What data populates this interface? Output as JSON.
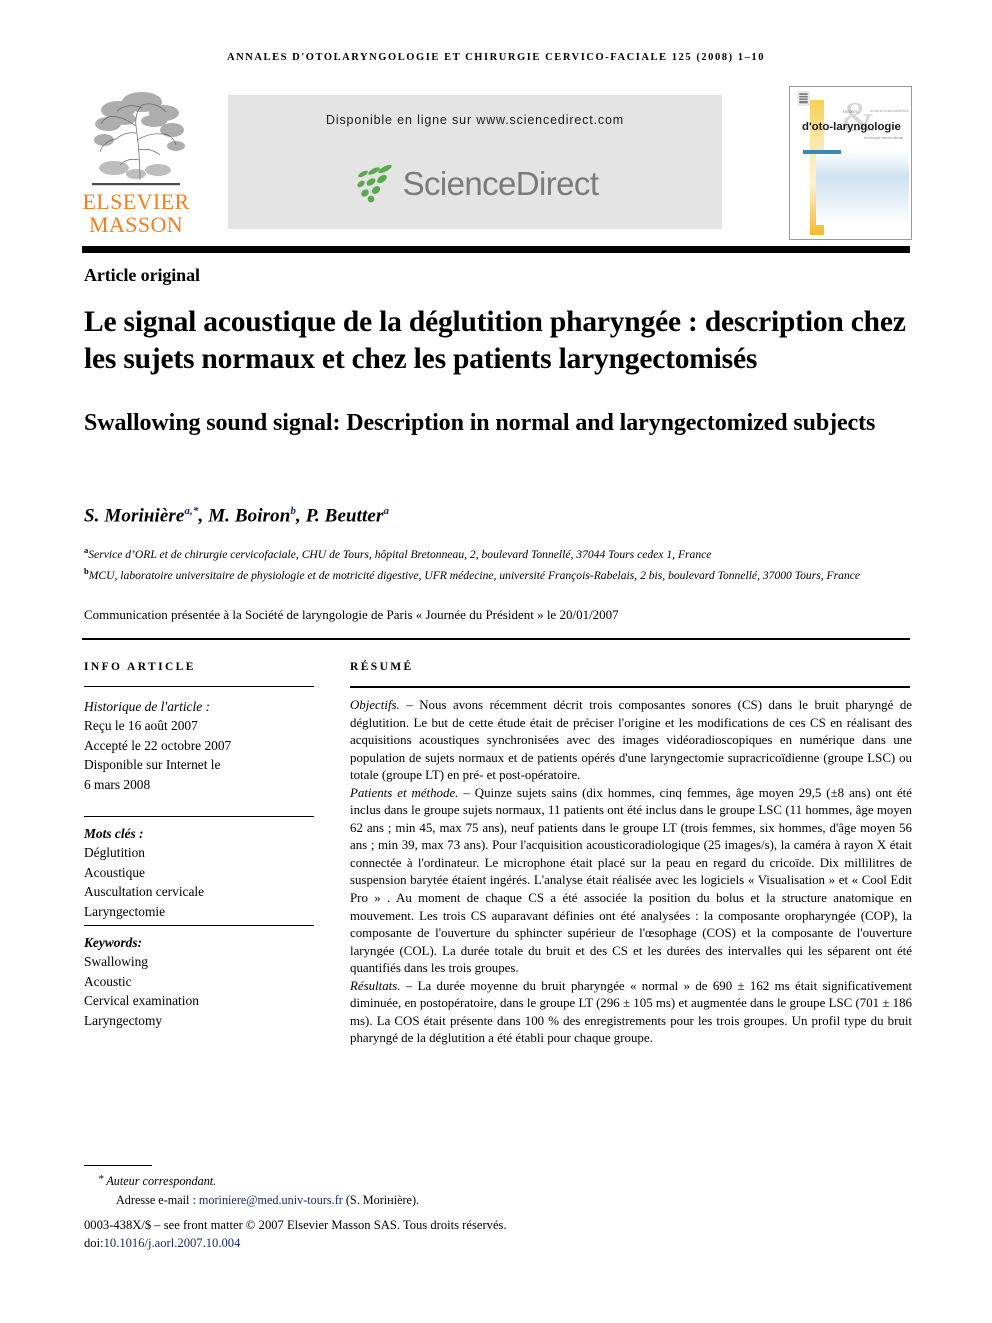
{
  "running_head": "Annales d'otolaryngologie et chirurgie cervico-faciale 125 (2008) 1–10",
  "masthead": {
    "publisher_logo_name": "elsevier-masson-logo",
    "publisher_line1": "ELSEVIER",
    "publisher_line2": "MASSON",
    "publisher_color": "#ef8022",
    "sciencedirect_availability": "Disponible en ligne sur www.sciencedirect.com",
    "sciencedirect_wordmark": "ScienceDirect",
    "sciencedirect_mark_color": "#5aa94f",
    "sciencedirect_word_color": "#7b7b7b",
    "banner_bg": "#e4e4e4",
    "journal_cover_title": "d'oto-laryngologie",
    "journal_cover_superline": "Annales",
    "journal_cover_subline": "et de chirurgie cervico-faciale",
    "journal_cover_accent_yellow": "#f5c53d",
    "journal_cover_accent_blue": "#4a8fc0"
  },
  "article": {
    "kicker": "Article original",
    "title_fr": "Le signal acoustique de la déglutition pharyngée : description chez les sujets normaux et chez les patients laryngectomisés",
    "title_en": "Swallowing sound signal: Description in normal and laryngectomized subjects",
    "authors": [
      {
        "name": "S. Moriнière",
        "display": "S. Moriнière",
        "sup": "a,*"
      },
      {
        "name": "M. Boiron",
        "display": "M. Boiron",
        "sup": "b"
      },
      {
        "name": "P. Beutter",
        "display": "P. Beutter",
        "sup": "a"
      }
    ],
    "authors_plain": "S. Moriнière a,*, M. Boiron b, P. Beutter a",
    "affiliations": [
      {
        "marker": "a",
        "text": "Service d’ORL et de chirurgie cervicofaciale, CHU de Tours, hôpital Bretonneau, 2, boulevard Tonnellé, 37044 Tours cedex 1, France"
      },
      {
        "marker": "b",
        "text": "MCU, laboratoire universitaire de physiologie et de motricité digestive, UFR médecine, université François-Rabelais, 2 bis, boulevard Tonnellé, 37000 Tours, France"
      }
    ],
    "communication": "Communication présentée à la Société de laryngologie de Paris « Journée du Président » le 20/01/2007"
  },
  "info_article": {
    "heading": "INFO ARTICLE",
    "history_label": "Historique de l'article :",
    "history": [
      "Reçu le 16 août 2007",
      "Accepté le  22 octobre 2007",
      "Disponible sur Internet le",
      "6 mars 2008"
    ],
    "motscles_label": "Mots clés :",
    "motscles": [
      "Déglutition",
      "Acoustique",
      "Auscultation cervicale",
      "Laryngectomie"
    ],
    "keywords_label": "Keywords:",
    "keywords": [
      "Swallowing",
      "Acoustic",
      "Cervical examination",
      "Laryngectomy"
    ]
  },
  "resume": {
    "heading": "RÉSUMÉ",
    "paragraphs": [
      {
        "lead": "Objectifs. – ",
        "body": "Nous avons récemment décrit trois composantes sonores (CS) dans le bruit pharyngé de déglutition. Le but de cette étude était de préciser l'origine et les modifications de ces CS en réalisant des acquisitions acoustiques synchronisées avec des images vidéoradioscopiques en numérique dans une population de sujets normaux et de patients opérés d'une laryngectomie supracricoïdienne (groupe LSC) ou totale (groupe LT) en pré- et post-opératoire."
      },
      {
        "lead": "Patients et méthode. – ",
        "body": "Quinze sujets sains (dix hommes, cinq femmes, âge moyen 29,5 (±8 ans) ont été inclus dans le groupe sujets normaux, 11 patients ont été inclus dans le groupe LSC (11 hommes, âge moyen 62 ans ; min 45, max 75 ans), neuf patients dans le groupe LT (trois femmes, six hommes, d'âge moyen 56 ans ; min 39, max 73 ans). Pour l'acquisition acousticoradiologique (25 images/s), la caméra à rayon X était connectée à l'ordinateur. Le microphone était placé sur la peau en regard du cricoïde. Dix millilitres de suspension barytée étaient ingérés. L'analyse était réalisée avec les logiciels « Visualisation » et « Cool Edit Pro » . Au moment de chaque CS a été associée la position du bolus et la structure anatomique en mouvement. Les trois CS auparavant définies ont été analysées : la composante oropharyngée (COP), la composante de l'ouverture du sphincter supérieur de l'œsophage (COS) et la composante de l'ouverture laryngée (COL). La durée totale du bruit et des CS et les durées des intervalles qui les séparent ont été quantifiés dans les trois groupes."
      },
      {
        "lead": "Résultats. – ",
        "body": "La durée moyenne du bruit pharyngée « normal » de 690 ± 162 ms était significativement diminuée, en postopératoire, dans le groupe LT (296 ± 105 ms) et augmentée dans le groupe LSC (701 ± 186 ms). La COS était présente dans 100 % des enregistrements pour les trois groupes. Un profil type du bruit pharyngé de la déglutition a été établi pour chaque groupe."
      }
    ]
  },
  "footer": {
    "corresponding_marker": "*",
    "corresponding_label": "Auteur correspondant.",
    "email_label": "Adresse e-mail :",
    "email": "moriniere@med.univ-tours.fr",
    "email_owner": "(S. Moriнière).",
    "issn_line": "0003-438X/$ – see front matter © 2007 Elsevier Masson SAS. Tous droits réservés.",
    "doi_label": "doi:",
    "doi": "10.1016/j.aorl.2007.10.004",
    "link_color": "#1b2a6b"
  }
}
